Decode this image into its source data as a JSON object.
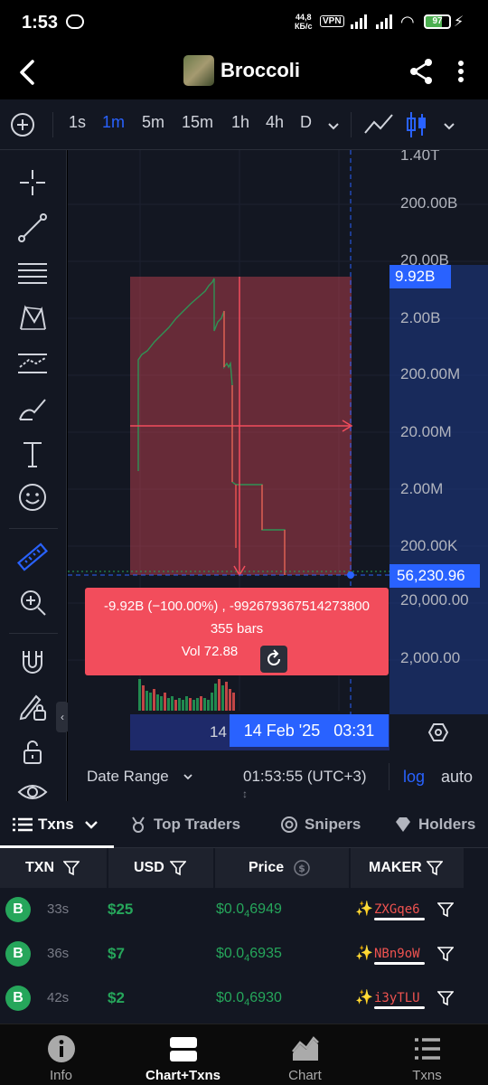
{
  "status_bar": {
    "time": "1:53",
    "net_speed_value": "44,8",
    "net_speed_unit": "КБ/с",
    "vpn": "VPN",
    "battery": "97"
  },
  "header": {
    "title": "Broccoli"
  },
  "toolbar": {
    "intervals": [
      "1s",
      "1m",
      "5m",
      "15m",
      "1h",
      "4h",
      "D"
    ],
    "active_interval": "1m"
  },
  "chart": {
    "price_axis_labels": [
      "1.40T",
      "200.00B",
      "20.00B",
      "2.00B",
      "200.00M",
      "20.00M",
      "2.00M",
      "200.00K",
      "20,000.00",
      "2,000.00"
    ],
    "measure_high_label": "9.92B",
    "current_price_label": "56,230.96",
    "measure_info": {
      "change": "-9.92B (−100.00%) , -992679367514273800",
      "bars": "355 bars",
      "volume": "Vol 72.88"
    },
    "time_axis_partial": "14",
    "time_highlight_label": "14 Feb '25   03:31"
  },
  "chart_footer": {
    "date_range": "Date Range",
    "clock": "01:53:55 (UTC+3)",
    "log": "log",
    "auto": "auto"
  },
  "txns": {
    "tabs": [
      "Txns",
      "Top Traders",
      "Snipers",
      "Holders"
    ],
    "columns": [
      "TXN",
      "USD",
      "Price",
      "MAKER"
    ],
    "rows": [
      {
        "type": "B",
        "age": "33s",
        "usd": "$25",
        "price_prefix": "$0.0",
        "price_sub": "4",
        "price_digits": "6949",
        "maker": "ZXGqe6"
      },
      {
        "type": "B",
        "age": "36s",
        "usd": "$7",
        "price_prefix": "$0.0",
        "price_sub": "4",
        "price_digits": "6935",
        "maker": "NBn9oW"
      },
      {
        "type": "B",
        "age": "42s",
        "usd": "$2",
        "price_prefix": "$0.0",
        "price_sub": "4",
        "price_digits": "6930",
        "maker": "i3yTLU"
      }
    ]
  },
  "bottom_nav": [
    "Info",
    "Chart+Txns",
    "Chart",
    "Txns"
  ],
  "colors": {
    "up": "#26a65b",
    "down": "#ef5350",
    "accent": "#2962ff",
    "measure_box": "#f24d5c"
  }
}
